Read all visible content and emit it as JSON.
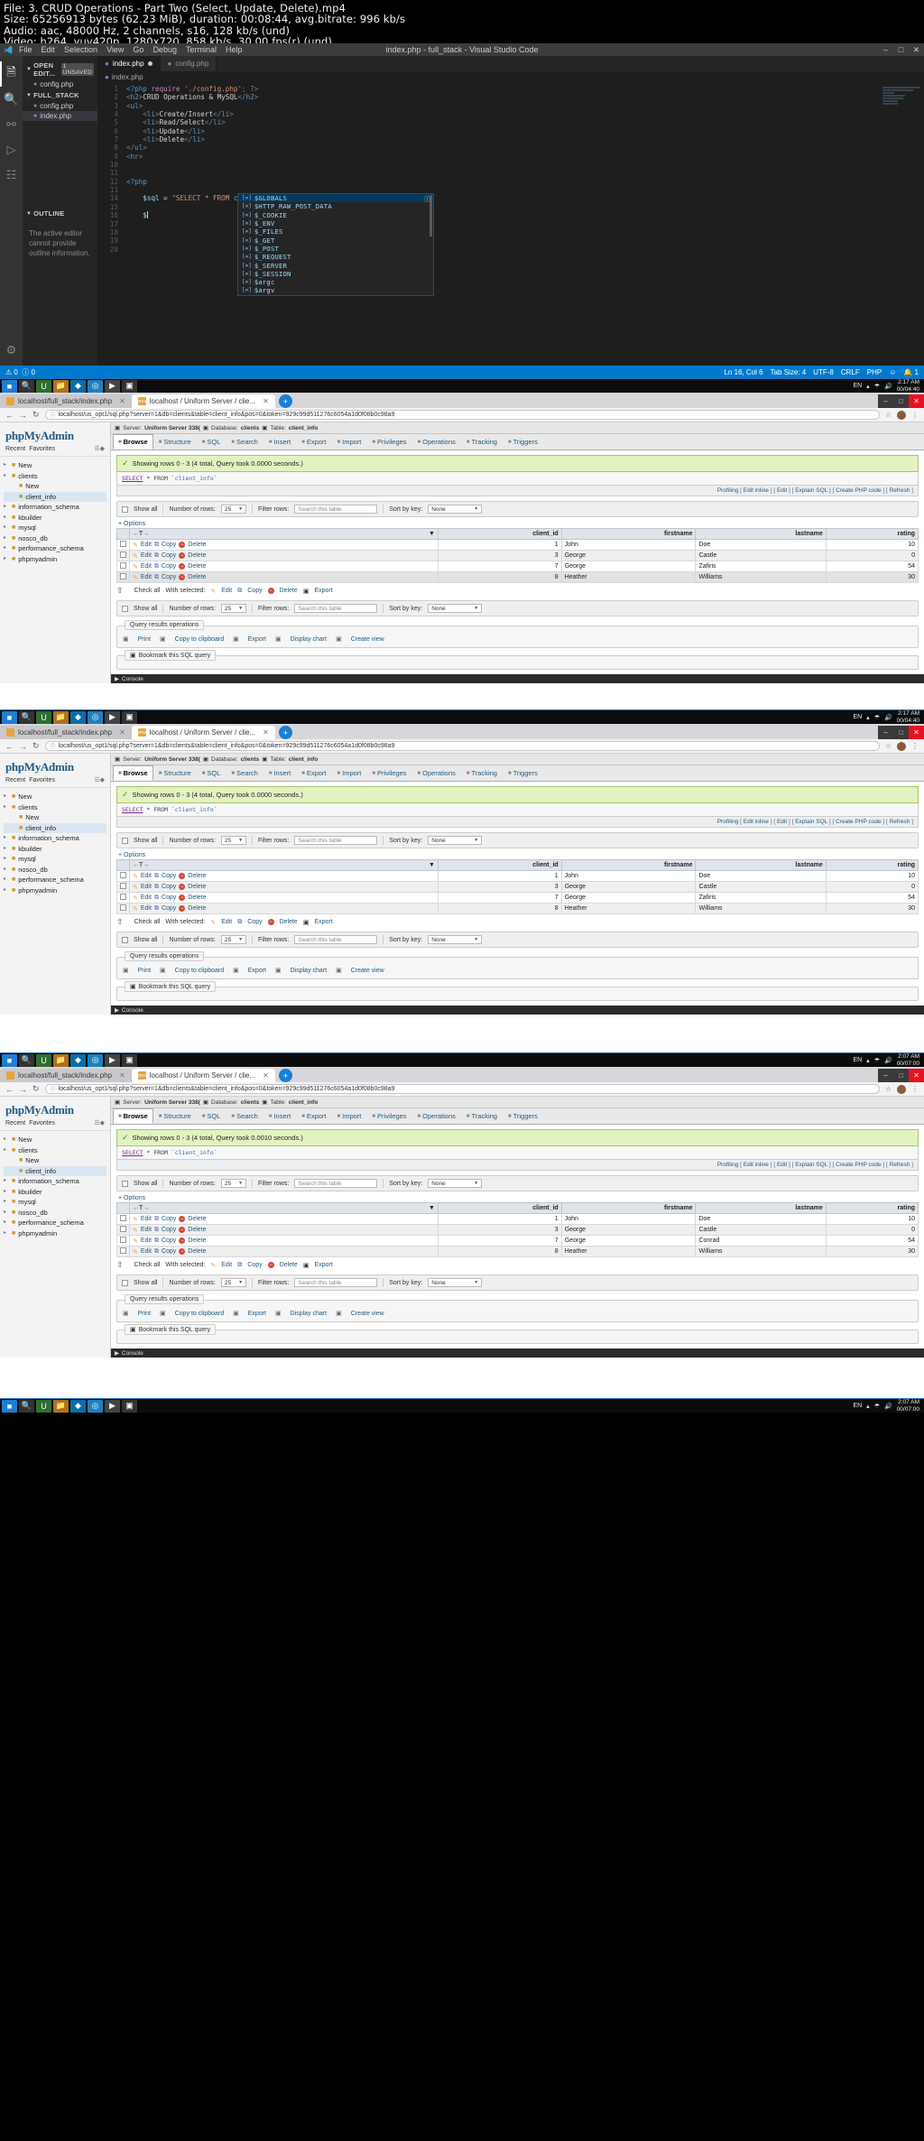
{
  "video_meta": {
    "file": "File: 3. CRUD Operations - Part Two (Select, Update, Delete).mp4",
    "size": "Size: 65256913 bytes (62.23 MiB), duration: 00:08:44, avg.bitrate: 996 kb/s",
    "audio": "Audio: aac, 48000 Hz, 2 channels, s16, 128 kb/s (und)",
    "video": "Video: h264, yuv420p, 1280x720, 858 kb/s, 30.00 fps(r) (und)"
  },
  "vscode": {
    "window_title": "index.php - full_stack - Visual Studio Code",
    "menu": [
      "File",
      "Edit",
      "Selection",
      "View",
      "Go",
      "Debug",
      "Terminal",
      "Help"
    ],
    "window_controls": [
      "–",
      "□",
      "✕"
    ],
    "activity_icons": [
      "files-icon",
      "search-icon",
      "source-control-icon",
      "debug-icon",
      "extensions-icon",
      "settings-gear-icon"
    ],
    "sidebar": {
      "title": "EXPLORER",
      "open_editors": {
        "label": "OPEN EDIT...",
        "badge": "1 UNSAVED",
        "items": [
          {
            "name": "config.php"
          }
        ]
      },
      "project": {
        "label": "FULL_STACK",
        "items": [
          {
            "name": "config.php"
          },
          {
            "name": "index.php"
          }
        ]
      },
      "outline": {
        "label": "OUTLINE",
        "message": "The active editor cannot provide outline information."
      }
    },
    "tabs": [
      {
        "label": "index.php",
        "dirty": true,
        "active": true
      },
      {
        "label": "config.php",
        "dirty": false,
        "active": false
      }
    ],
    "breadcrumb": "index.php",
    "code_lines": [
      {
        "n": 1,
        "segments": [
          {
            "t": "<?php ",
            "c": "tk-php"
          },
          {
            "t": "require ",
            "c": "tk-kw"
          },
          {
            "t": "'./config.php'",
            "c": "tk-str"
          },
          {
            "t": "; ?>",
            "c": "tk-punct"
          }
        ]
      },
      {
        "n": 2,
        "segments": [
          {
            "t": "<",
            "c": "tk-punct"
          },
          {
            "t": "h2",
            "c": "tk-tag"
          },
          {
            "t": ">",
            "c": "tk-punct"
          },
          {
            "t": "CRUD Operations & MySQL",
            "c": "tk-txt"
          },
          {
            "t": "</",
            "c": "tk-punct"
          },
          {
            "t": "h2",
            "c": "tk-tag"
          },
          {
            "t": ">",
            "c": "tk-punct"
          }
        ]
      },
      {
        "n": 3,
        "segments": [
          {
            "t": "<",
            "c": "tk-punct"
          },
          {
            "t": "ul",
            "c": "tk-tag"
          },
          {
            "t": ">",
            "c": "tk-punct"
          }
        ]
      },
      {
        "n": 4,
        "segments": [
          {
            "t": "    <",
            "c": "tk-punct"
          },
          {
            "t": "li",
            "c": "tk-tag"
          },
          {
            "t": ">",
            "c": "tk-punct"
          },
          {
            "t": "Create/Insert",
            "c": "tk-txt"
          },
          {
            "t": "</",
            "c": "tk-punct"
          },
          {
            "t": "li",
            "c": "tk-tag"
          },
          {
            "t": ">",
            "c": "tk-punct"
          }
        ]
      },
      {
        "n": 5,
        "segments": [
          {
            "t": "    <",
            "c": "tk-punct"
          },
          {
            "t": "li",
            "c": "tk-tag"
          },
          {
            "t": ">",
            "c": "tk-punct"
          },
          {
            "t": "Read/Select",
            "c": "tk-txt"
          },
          {
            "t": "</",
            "c": "tk-punct"
          },
          {
            "t": "li",
            "c": "tk-tag"
          },
          {
            "t": ">",
            "c": "tk-punct"
          }
        ]
      },
      {
        "n": 6,
        "segments": [
          {
            "t": "    <",
            "c": "tk-punct"
          },
          {
            "t": "li",
            "c": "tk-tag"
          },
          {
            "t": ">",
            "c": "tk-punct"
          },
          {
            "t": "Update",
            "c": "tk-txt"
          },
          {
            "t": "</",
            "c": "tk-punct"
          },
          {
            "t": "li",
            "c": "tk-tag"
          },
          {
            "t": ">",
            "c": "tk-punct"
          }
        ]
      },
      {
        "n": 7,
        "segments": [
          {
            "t": "    <",
            "c": "tk-punct"
          },
          {
            "t": "li",
            "c": "tk-tag"
          },
          {
            "t": ">",
            "c": "tk-punct"
          },
          {
            "t": "Delete",
            "c": "tk-txt"
          },
          {
            "t": "</",
            "c": "tk-punct"
          },
          {
            "t": "li",
            "c": "tk-tag"
          },
          {
            "t": ">",
            "c": "tk-punct"
          }
        ]
      },
      {
        "n": 8,
        "segments": [
          {
            "t": "</",
            "c": "tk-punct"
          },
          {
            "t": "ul",
            "c": "tk-tag"
          },
          {
            "t": ">",
            "c": "tk-punct"
          }
        ]
      },
      {
        "n": 9,
        "segments": [
          {
            "t": "<",
            "c": "tk-punct"
          },
          {
            "t": "hr",
            "c": "tk-tag"
          },
          {
            "t": ">",
            "c": "tk-punct"
          }
        ]
      },
      {
        "n": 10,
        "segments": []
      },
      {
        "n": 11,
        "segments": []
      },
      {
        "n": 12,
        "segments": [
          {
            "t": "<?php",
            "c": "tk-php"
          }
        ]
      },
      {
        "n": 13,
        "segments": []
      },
      {
        "n": 14,
        "segments": [
          {
            "t": "    ",
            "c": "tk-txt"
          },
          {
            "t": "$sql",
            "c": "tk-var"
          },
          {
            "t": " = ",
            "c": "tk-txt"
          },
          {
            "t": "\"SELECT * FROM client_info\"",
            "c": "tk-str"
          },
          {
            "t": ";",
            "c": "tk-txt"
          }
        ]
      },
      {
        "n": 15,
        "segments": []
      },
      {
        "n": 16,
        "segments": [
          {
            "t": "    ",
            "c": "tk-txt"
          },
          {
            "t": "$",
            "c": "tk-var"
          }
        ]
      },
      {
        "n": 17,
        "segments": []
      },
      {
        "n": 18,
        "segments": []
      },
      {
        "n": 19,
        "segments": []
      },
      {
        "n": 20,
        "segments": []
      }
    ],
    "autocomplete": {
      "items": [
        "$GLOBALS",
        "$HTTP_RAW_POST_DATA",
        "$_COOKIE",
        "$_ENV",
        "$_FILES",
        "$_GET",
        "$_POST",
        "$_REQUEST",
        "$_SERVER",
        "$_SESSION",
        "$argc",
        "$argv"
      ],
      "selected_index": 0,
      "item_icon": "variable-icon"
    },
    "status_bar": {
      "problems_errors": "0",
      "problems_warnings": "0",
      "position": "Ln 16, Col 6",
      "tab_size": "Tab Size: 4",
      "encoding": "UTF-8",
      "eol": "CRLF",
      "language": "PHP",
      "bell": "1"
    }
  },
  "taskbar": {
    "lang": "EN",
    "clock_time": "2:17 AM",
    "clock_date": "00/04:40",
    "icons": [
      "start-icon",
      "search-icon",
      "uniform-server-icon",
      "folder-icon",
      "vscode-icon",
      "chrome-icon",
      "media-icon",
      "app-icon"
    ]
  },
  "browser": {
    "tabs": [
      {
        "label": "localhost/full_stack/index.php",
        "active": false
      },
      {
        "label": "localhost / Uniform Server / clie...",
        "active": true
      }
    ],
    "new_tab": "+",
    "window_controls": [
      "–",
      "□",
      "✕"
    ],
    "nav": {
      "back": "←",
      "forward": "→",
      "reload": "↻"
    },
    "url": "localhost/us_opt1/sql.php?server=1&db=clients&table=client_info&pos=0&token=929c99d511276c6054a1d0f08b0c98a9",
    "star": "☆",
    "menu": "⋮"
  },
  "pma": {
    "logo": "phpMyAdmin",
    "recent": "Recent",
    "favorites": "Favorites",
    "tree": [
      {
        "label": "New",
        "depth": 0,
        "icon": "new-icon"
      },
      {
        "label": "clients",
        "depth": 0,
        "icon": "db-icon"
      },
      {
        "label": "New",
        "depth": 1,
        "icon": "new-icon"
      },
      {
        "label": "client_info",
        "depth": 1,
        "icon": "table-icon",
        "selected": true
      },
      {
        "label": "information_schema",
        "depth": 0,
        "icon": "db-icon"
      },
      {
        "label": "kbuilder",
        "depth": 0,
        "icon": "db-icon"
      },
      {
        "label": "mysql",
        "depth": 0,
        "icon": "db-icon"
      },
      {
        "label": "nosco_db",
        "depth": 0,
        "icon": "db-icon"
      },
      {
        "label": "performance_schema",
        "depth": 0,
        "icon": "db-icon"
      },
      {
        "label": "phpmyadmin",
        "depth": 0,
        "icon": "db-icon"
      }
    ],
    "breadcrumb": {
      "server_label": "Server:",
      "server": "Uniform Server 338(",
      "db_label": "Database:",
      "db": "clients",
      "table_label": "Table:",
      "table": "client_info"
    },
    "tabs": [
      {
        "label": "Browse",
        "icon": "browse-icon",
        "active": true
      },
      {
        "label": "Structure",
        "icon": "structure-icon",
        "active": false
      },
      {
        "label": "SQL",
        "icon": "sql-icon",
        "active": false
      },
      {
        "label": "Search",
        "icon": "search-icon",
        "active": false
      },
      {
        "label": "Insert",
        "icon": "insert-icon",
        "active": false
      },
      {
        "label": "Export",
        "icon": "export-icon",
        "active": false
      },
      {
        "label": "Import",
        "icon": "import-icon",
        "active": false
      },
      {
        "label": "Privileges",
        "icon": "privileges-icon",
        "active": false
      },
      {
        "label": "Operations",
        "icon": "operations-icon",
        "active": false
      },
      {
        "label": "Tracking",
        "icon": "tracking-icon",
        "active": false
      },
      {
        "label": "Triggers",
        "icon": "triggers-icon",
        "active": false
      }
    ],
    "sql_query": {
      "keyword": "SELECT",
      "rest": " * FROM ",
      "table": "`client_info`"
    },
    "sql_actions": [
      "Profiling [ Edit inline ] [ Edit ] [ Explain SQL ] [ Create PHP code ] [ Refresh ]"
    ],
    "sql_action_items": [
      "Profiling",
      "Edit inline",
      "Edit",
      "Explain SQL",
      "Create PHP code",
      "Refresh"
    ],
    "toolbar": {
      "show_all": "Show all",
      "number_of_rows": "Number of rows:",
      "rows_value": "25",
      "filter_rows": "Filter rows:",
      "filter_placeholder": "Search this table",
      "sort_by_key": "Sort by key:",
      "sort_value": "None"
    },
    "options": "+ Options",
    "columns": [
      "client_id",
      "firstname",
      "lastname",
      "rating"
    ],
    "row_actions": {
      "edit": "Edit",
      "copy": "Copy",
      "delete": "Delete"
    },
    "footer": {
      "check_all": "Check all",
      "with_selected": "With selected:",
      "edit": "Edit",
      "copy": "Copy",
      "delete": "Delete",
      "export": "Export"
    },
    "query_results": {
      "legend": "Query results operations",
      "items": [
        "Print",
        "Copy to clipboard",
        "Export",
        "Display chart",
        "Create view"
      ]
    },
    "bookmark": "Bookmark this SQL query",
    "console": "Console"
  },
  "panels": [
    {
      "status": "Showing rows 0 - 3 (4 total, Query took 0.0000 seconds.)",
      "highlight_row": 3,
      "rows": [
        {
          "client_id": "1",
          "firstname": "John",
          "lastname": "Doe",
          "rating": "10"
        },
        {
          "client_id": "3",
          "firstname": "George",
          "lastname": "Castle",
          "rating": "0"
        },
        {
          "client_id": "7",
          "firstname": "George",
          "lastname": "Zafiris",
          "rating": "54"
        },
        {
          "client_id": "8",
          "firstname": "Heather",
          "lastname": "Williams",
          "rating": "30"
        }
      ],
      "clock_time": "2:17 AM",
      "clock_date": "00/04:40"
    },
    {
      "status": "Showing rows 0 - 3 (4 total, Query took 0.0000 seconds.)",
      "highlight_row": -1,
      "rows": [
        {
          "client_id": "1",
          "firstname": "John",
          "lastname": "Doe",
          "rating": "10"
        },
        {
          "client_id": "3",
          "firstname": "George",
          "lastname": "Castle",
          "rating": "0"
        },
        {
          "client_id": "7",
          "firstname": "George",
          "lastname": "Zafiris",
          "rating": "54"
        },
        {
          "client_id": "8",
          "firstname": "Heather",
          "lastname": "Williams",
          "rating": "30"
        }
      ],
      "clock_time": "2:17 AM",
      "clock_date": "00/04:40"
    },
    {
      "status": "Showing rows 0 - 3 (4 total, Query took 0.0010 seconds.)",
      "highlight_row": -1,
      "rows": [
        {
          "client_id": "1",
          "firstname": "John",
          "lastname": "Doe",
          "rating": "10"
        },
        {
          "client_id": "3",
          "firstname": "George",
          "lastname": "Castle",
          "rating": "0"
        },
        {
          "client_id": "7",
          "firstname": "George",
          "lastname": "Conrad",
          "rating": "54"
        },
        {
          "client_id": "8",
          "firstname": "Heather",
          "lastname": "Williams",
          "rating": "30"
        }
      ],
      "clock_time": "2:07 AM",
      "clock_date": "00/07:00"
    }
  ],
  "colors": {
    "vscode_bg": "#1e1e1e",
    "vscode_status": "#007acc",
    "pma_accent": "#235a81",
    "success_bg": "#e3f2c1",
    "taskbar": "#0c0c0c"
  }
}
